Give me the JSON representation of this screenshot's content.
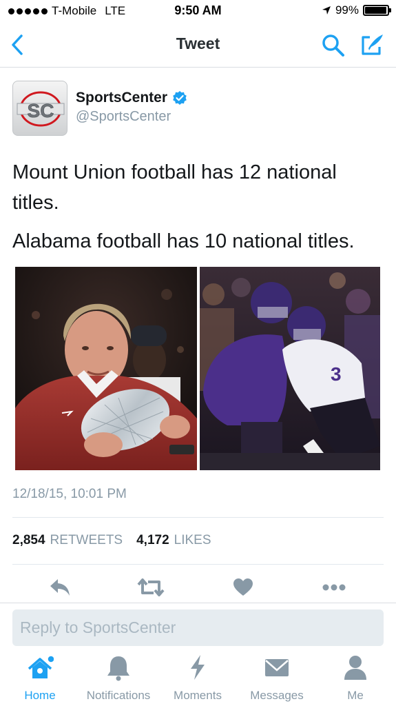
{
  "status_bar": {
    "carrier": "T-Mobile",
    "network": "LTE",
    "time": "9:50 AM",
    "battery": "99%",
    "battery_level": 0.99
  },
  "nav": {
    "title": "Tweet",
    "back_icon": "chevron-left-icon",
    "search_icon": "search-icon",
    "compose_icon": "compose-icon"
  },
  "tweet": {
    "author_name": "SportsCenter",
    "handle": "@SportsCenter",
    "verified": true,
    "avatar_text": "SC",
    "text_line_1": "Mount Union football has 12 national titles.",
    "text_line_2": "Alabama football has 10 national titles.",
    "media": [
      {
        "description": "coach holding crystal trophy",
        "jersey_text": ""
      },
      {
        "description": "football players celebrating",
        "jersey_number": "3"
      }
    ],
    "timestamp": "12/18/15, 10:01 PM",
    "retweet_count": "2,854",
    "retweet_label": "RETWEETS",
    "like_count": "4,172",
    "like_label": "LIKES"
  },
  "actions": [
    "reply-icon",
    "retweet-icon",
    "heart-icon",
    "more-icon"
  ],
  "reply": {
    "placeholder": "Reply to SportsCenter"
  },
  "tabs": [
    {
      "label": "Home",
      "icon": "home-icon",
      "active": true
    },
    {
      "label": "Notifications",
      "icon": "bell-icon",
      "active": false
    },
    {
      "label": "Moments",
      "icon": "lightning-icon",
      "active": false
    },
    {
      "label": "Messages",
      "icon": "envelope-icon",
      "active": false
    },
    {
      "label": "Me",
      "icon": "person-icon",
      "active": false
    }
  ],
  "colors": {
    "accent": "#1da1f2",
    "muted": "#8899a6",
    "text": "#14171a"
  }
}
